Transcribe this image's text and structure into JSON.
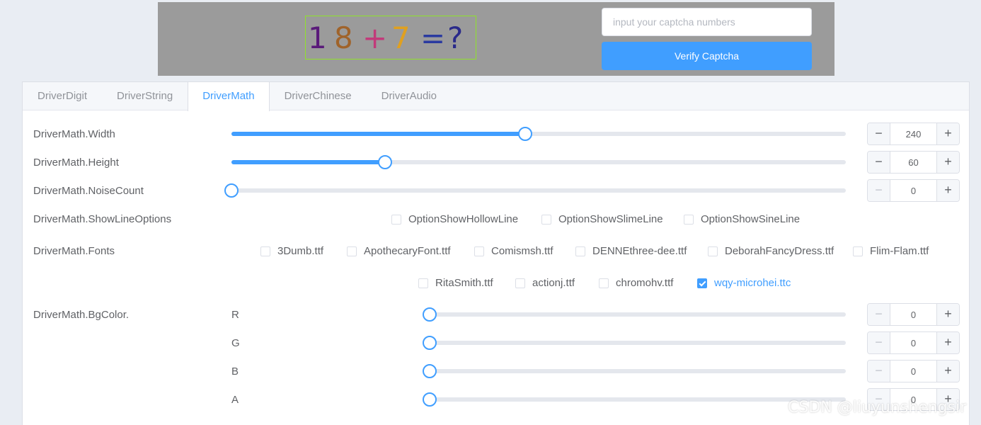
{
  "captcha": {
    "chars": [
      {
        "text": "1",
        "color": "#5a1a7a"
      },
      {
        "text": "8",
        "color": "#a0632a"
      },
      {
        "text": "+",
        "color": "#c23a7a"
      },
      {
        "text": "7",
        "color": "#e0a020"
      },
      {
        "text": "=",
        "color": "#2a3aa0"
      },
      {
        "text": "?",
        "color": "#2a2a8a"
      }
    ],
    "input_value": "",
    "input_placeholder": "input your captcha numbers",
    "verify_label": "Verify Captcha"
  },
  "tabs": [
    {
      "label": "DriverDigit",
      "active": false
    },
    {
      "label": "DriverString",
      "active": false
    },
    {
      "label": "DriverMath",
      "active": true
    },
    {
      "label": "DriverChinese",
      "active": false
    },
    {
      "label": "DriverAudio",
      "active": false
    }
  ],
  "form": {
    "width": {
      "label": "DriverMath.Width",
      "value": "240",
      "slider_fraction": 0.478
    },
    "height": {
      "label": "DriverMath.Height",
      "value": "60",
      "slider_fraction": 0.25
    },
    "noise": {
      "label": "DriverMath.NoiseCount",
      "value": "0",
      "slider_fraction": 0
    },
    "line_options": {
      "label": "DriverMath.ShowLineOptions",
      "options": [
        {
          "label": "OptionShowHollowLine",
          "checked": false
        },
        {
          "label": "OptionShowSlimeLine",
          "checked": false
        },
        {
          "label": "OptionShowSineLine",
          "checked": false
        }
      ]
    },
    "fonts": {
      "label": "DriverMath.Fonts",
      "options": [
        {
          "label": "3Dumb.ttf",
          "checked": false
        },
        {
          "label": "ApothecaryFont.ttf",
          "checked": false
        },
        {
          "label": "Comismsh.ttf",
          "checked": false
        },
        {
          "label": "DENNEthree-dee.ttf",
          "checked": false
        },
        {
          "label": "DeborahFancyDress.ttf",
          "checked": false
        },
        {
          "label": "Flim-Flam.ttf",
          "checked": false
        },
        {
          "label": "RitaSmith.ttf",
          "checked": false
        },
        {
          "label": "actionj.ttf",
          "checked": false
        },
        {
          "label": "chromohv.ttf",
          "checked": false
        },
        {
          "label": "wqy-microhei.ttc",
          "checked": true
        }
      ]
    },
    "bgcolor": {
      "label": "DriverMath.BgColor.",
      "channels": [
        {
          "label": "R",
          "value": "0",
          "slider_fraction": 0
        },
        {
          "label": "G",
          "value": "0",
          "slider_fraction": 0
        },
        {
          "label": "B",
          "value": "0",
          "slider_fraction": 0
        },
        {
          "label": "A",
          "value": "0",
          "slider_fraction": 0
        }
      ]
    }
  },
  "stepper_icons": {
    "minus": "−",
    "plus": "+"
  },
  "watermark": "CSDN @liuyunshengsir",
  "colors": {
    "accent": "#409eff",
    "captcha_bg": "#9b9b9b",
    "captcha_border": "#8fe32a"
  }
}
